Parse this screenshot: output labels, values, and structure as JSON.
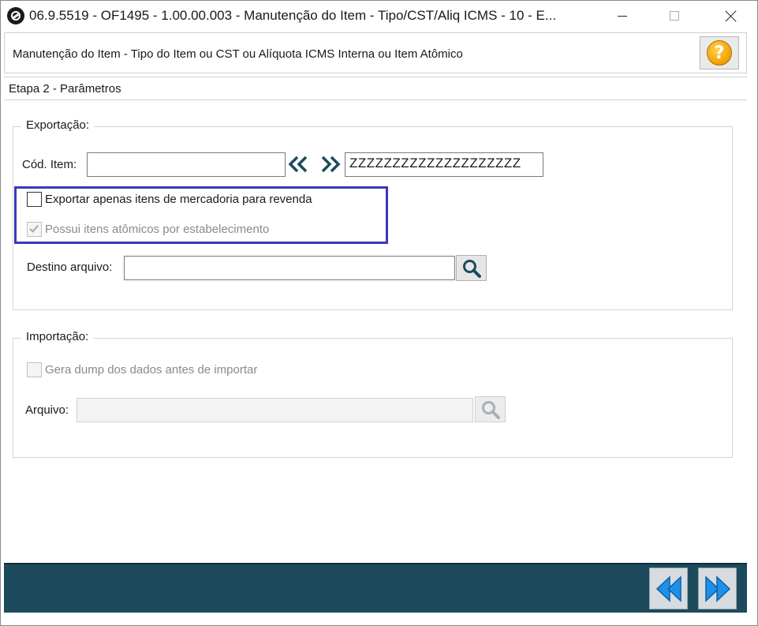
{
  "window": {
    "title": "06.9.5519 - OF1495 - 1.00.00.003 - Manutenção do Item - Tipo/CST/Aliq ICMS - 10 - E..."
  },
  "header": {
    "title": "Manutenção do Item - Tipo do Item ou CST ou Alíquota ICMS Interna ou Item Atômico",
    "help_label": "?"
  },
  "step": {
    "label": "Etapa 2 - Parâmetros"
  },
  "export": {
    "legend": "Exportação:",
    "cod_item_label": "Cód. Item:",
    "cod_item_from": "",
    "cod_item_to": "ZZZZZZZZZZZZZZZZZZZZ",
    "checkbox_revenda": {
      "label": "Exportar apenas itens de mercadoria para revenda",
      "checked": false,
      "enabled": true
    },
    "checkbox_atomicos": {
      "label": "Possui itens atômicos por estabelecimento",
      "checked": true,
      "enabled": false
    },
    "destino_label": "Destino arquivo:",
    "destino_value": ""
  },
  "import": {
    "legend": "Importação:",
    "checkbox_dump": {
      "label": "Gera dump dos dados antes de importar",
      "checked": false,
      "enabled": false
    },
    "arquivo_label": "Arquivo:",
    "arquivo_value": ""
  },
  "colors": {
    "bottom_bar": "#1c4a5c",
    "highlight": "#3a3ab8",
    "nav_arrow": "#1e90e8",
    "chevron": "#1c4a5c"
  },
  "icons": {
    "first": "double-chevron-left-icon",
    "last": "double-chevron-right-icon",
    "search": "search-icon",
    "prev": "prev-step-icon",
    "next": "next-step-icon",
    "help": "help-icon"
  }
}
